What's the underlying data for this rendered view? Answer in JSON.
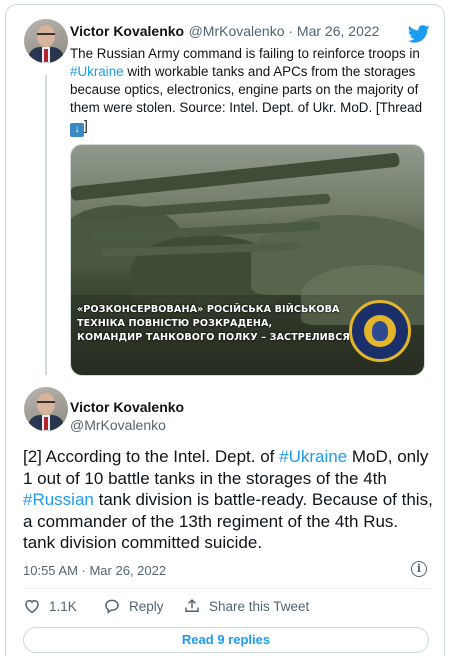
{
  "tweet1": {
    "name": "Victor Kovalenko",
    "meta": "@MrKovalenko · Mar 26, 2022",
    "text_before": "The Russian Army command is failing to reinforce troops in ",
    "hashtag": "#Ukraine",
    "text_after": " with workable tanks and APCs from the storages because optics, electronics, engine parts on the majority of them were stolen. Source: Intel. Dept. of Ukr. MoD. [Thread ",
    "emoji": "⬇️",
    "text_end": "]",
    "media": {
      "caption_line1": "«РОЗКОНСЕРВОВАНА» РОСІЙСЬКА ВІЙСЬКОВА",
      "caption_line2": "ТЕХНІКА ПОВНІСТЮ РОЗКРАДЕНА,",
      "caption_line3": "КОМАНДИР ТАНКОВОГО ПОЛКУ – ЗАСТРЕЛИВСЯ"
    }
  },
  "tweet2": {
    "name": "Victor Kovalenko",
    "handle": "@MrKovalenko",
    "t1": "[2] According to the Intel. Dept. of ",
    "tag1": "#Ukraine",
    "t2": " MoD, only 1 out of 10 battle tanks in the storages of the 4th ",
    "tag2": "#Russian",
    "t3": " tank division is battle-ready. Because of this, a commander of the 13th regiment of the 4th Rus. tank division committed suicide.",
    "timestamp": "10:55 AM · Mar 26, 2022",
    "likes": "1.1K",
    "reply_label": "Reply",
    "share_label": "Share this Tweet",
    "read_replies": "Read 9 replies"
  },
  "colors": {
    "link": "#1d9bf0",
    "text": "#0f1419",
    "secondary": "#536471",
    "border": "#cfd9de"
  }
}
